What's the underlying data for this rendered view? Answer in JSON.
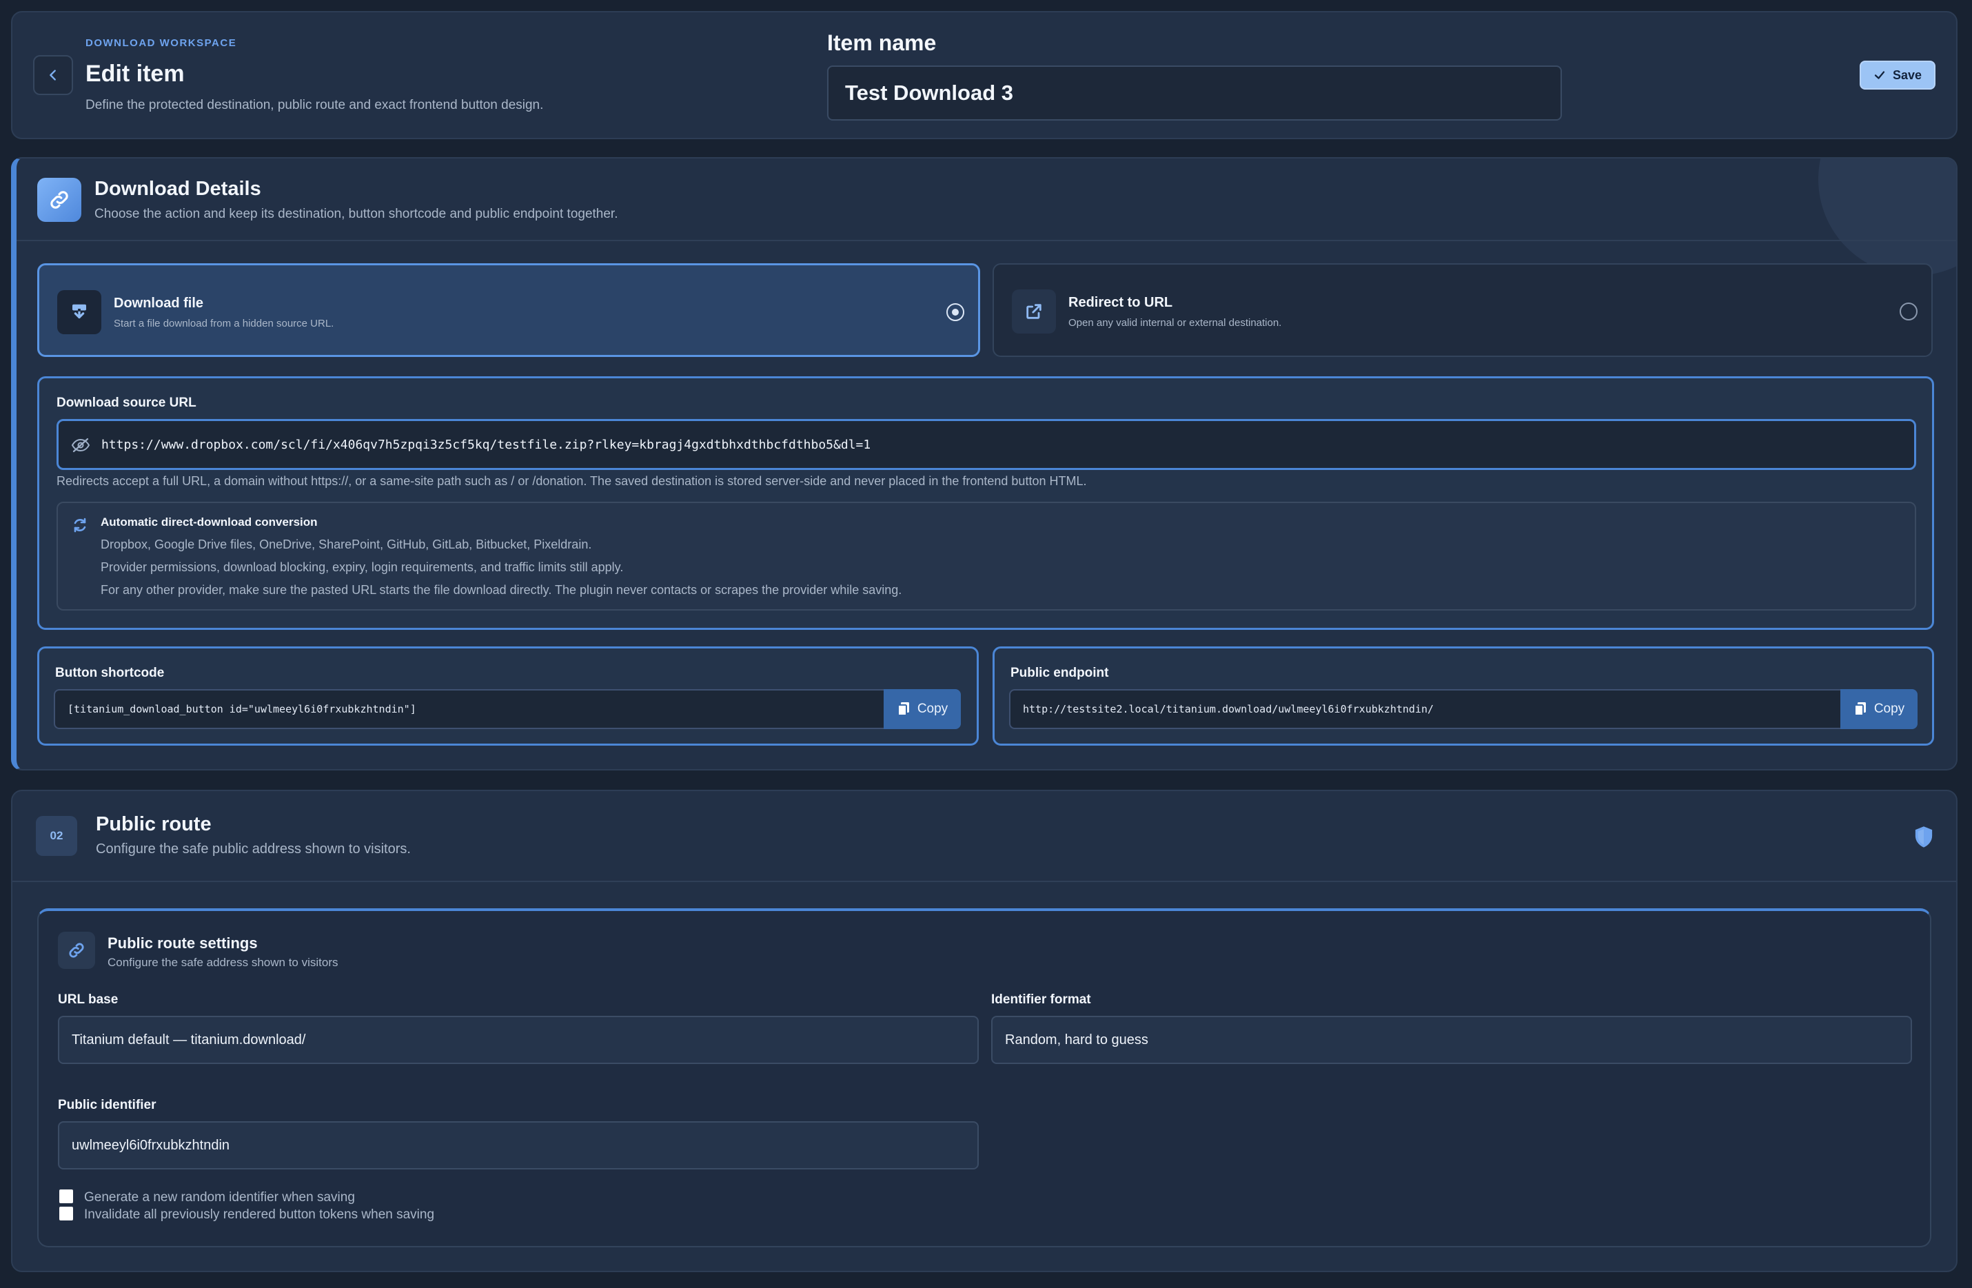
{
  "header": {
    "eyebrow": "DOWNLOAD WORKSPACE",
    "title": "Edit item",
    "subtitle": "Define the protected destination, public route and exact frontend button design.",
    "item_name_label": "Item name",
    "item_name_value": "Test Download 3",
    "save_label": "Save"
  },
  "download_details": {
    "title": "Download Details",
    "subtitle": "Choose the action and keep its destination, button shortcode and public endpoint together.",
    "options": [
      {
        "title": "Download file",
        "subtitle": "Start a file download from a hidden source URL.",
        "selected": true
      },
      {
        "title": "Redirect to URL",
        "subtitle": "Open any valid internal or external destination.",
        "selected": false
      }
    ],
    "source_label": "Download source URL",
    "source_value": "https://www.dropbox.com/scl/fi/x406qv7h5zpqi3z5cf5kq/testfile.zip?rlkey=kbragj4gxdtbhxdthbcfdthbo5&dl=1",
    "help_text": "Redirects accept a full URL, a domain without https://, or a same-site path such as / or /donation. The saved destination is stored server-side and never placed in the frontend button HTML.",
    "conversion": {
      "title": "Automatic direct-download conversion",
      "lines": [
        "Dropbox, Google Drive files, OneDrive, SharePoint, GitHub, GitLab, Bitbucket, Pixeldrain.",
        "Provider permissions, download blocking, expiry, login requirements, and traffic limits still apply.",
        "For any other provider, make sure the pasted URL starts the file download directly. The plugin never contacts or scrapes the provider while saving."
      ]
    },
    "shortcode_label": "Button shortcode",
    "shortcode_value": "[titanium_download_button id=\"uwlmeeyl6i0frxubkzhtndin\"]",
    "endpoint_label": "Public endpoint",
    "endpoint_value": "http://testsite2.local/titanium.download/uwlmeeyl6i0frxubkzhtndin/",
    "copy_label": "Copy"
  },
  "public_route": {
    "badge": "02",
    "title": "Public route",
    "subtitle": "Configure the safe public address shown to visitors.",
    "settings_title": "Public route settings",
    "settings_subtitle": "Configure the safe address shown to visitors",
    "url_base_label": "URL base",
    "url_base_value": "Titanium default — titanium.download/",
    "identifier_format_label": "Identifier format",
    "identifier_format_value": "Random, hard to guess",
    "public_identifier_label": "Public identifier",
    "public_identifier_value": "uwlmeeyl6i0frxubkzhtndin",
    "checkboxes": [
      {
        "label": "Generate a new random identifier when saving",
        "checked": false
      },
      {
        "label": "Invalidate all previously rendered button tokens when saving",
        "checked": false
      }
    ]
  },
  "colors": {
    "background": "#182231",
    "panel": "#223046",
    "accent": "#4b86d6",
    "accent_light": "#9cc4f5"
  },
  "icons": [
    "chevron-left-icon",
    "check-icon",
    "link-icon",
    "download-icon",
    "external-link-icon",
    "eye-off-icon",
    "refresh-icon",
    "copy-icon",
    "shield-icon"
  ]
}
